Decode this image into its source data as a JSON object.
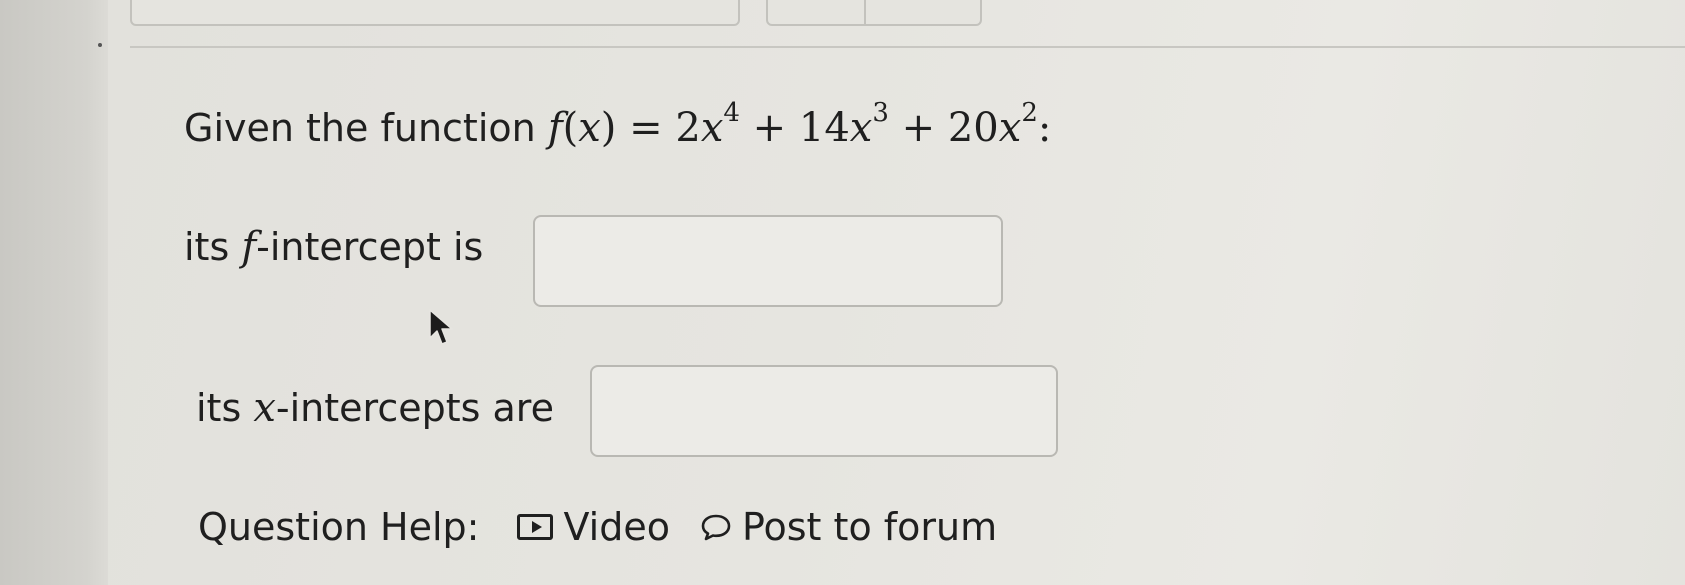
{
  "question": {
    "prompt_text": "Given the function",
    "function_lhs": "f(x) = ",
    "terms": [
      {
        "coef": "2",
        "var": "x",
        "exp": "4"
      },
      {
        "coef": "14",
        "var": "x",
        "exp": "3"
      },
      {
        "coef": "20",
        "var": "x",
        "exp": "2"
      }
    ],
    "plus": "+",
    "trailing": ":"
  },
  "f_intercept": {
    "label_prefix": "its ",
    "label_var": "f",
    "label_suffix": "-intercept is",
    "value": ""
  },
  "x_intercepts": {
    "label_prefix": "its ",
    "label_var": "x",
    "label_suffix": "-intercepts are",
    "value": ""
  },
  "help": {
    "label": "Question Help:",
    "video_label": "Video",
    "forum_label": "Post to forum"
  },
  "icons": {
    "video": "video-play-icon",
    "forum": "speech-bubble-icon",
    "cursor": "mouse-pointer-icon"
  }
}
